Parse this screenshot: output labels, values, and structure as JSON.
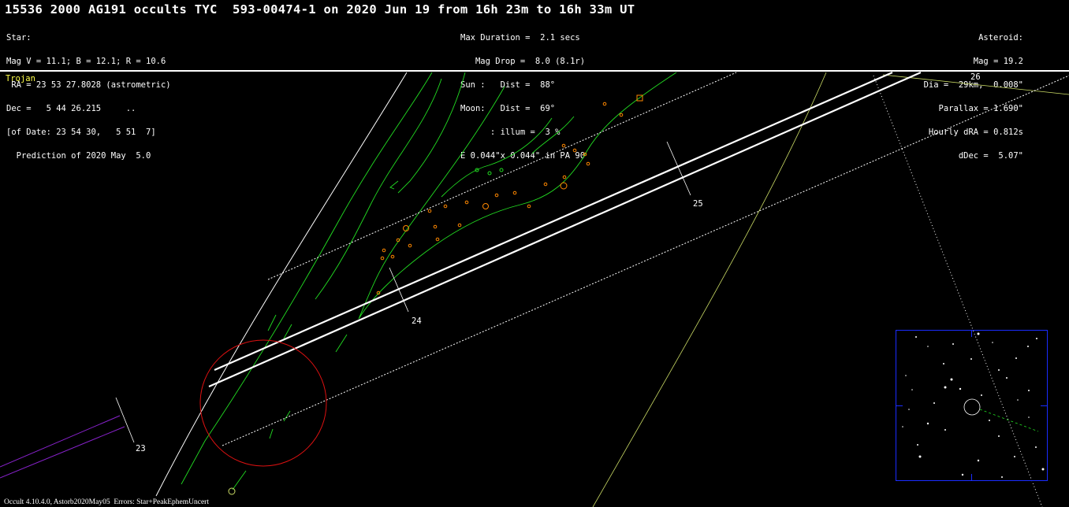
{
  "title": "15536 2000 AG191 occults TYC  593-00474-1 on 2020 Jun 19 from 16h 23m to 16h 33m UT",
  "star_block": [
    "Star:",
    "Mag V = 11.1; B = 12.1; R = 10.6",
    " RA = 23 53 27.8028 (astrometric)",
    "Dec =   5 44 26.215     ..",
    "[of Date: 23 54 30,   5 51  7]",
    "  Prediction of 2020 May  5.0"
  ],
  "event_block": [
    "Max Duration =  2.1 secs",
    "   Mag Drop =  8.0 (8.1r)",
    "Sun :   Dist =  88°",
    "Moon:   Dist =  69°",
    "      : illum =  3 %",
    "E 0.044\"x 0.044\" in PA 90"
  ],
  "asteroid_block": [
    "Asteroid:",
    "Mag = 19.2",
    "Dia =  29km,  0.008\"",
    "Parallax = 1.690\"",
    "Hourly dRA = 0.812s",
    "dDec =  5.07\""
  ],
  "class_label": "Trojan",
  "footer": "Occult 4.10.4.0, Astorb2020May05  Errors: Star+PeakEphemUncert",
  "time_labels": [
    "23",
    "24",
    "25",
    "26"
  ],
  "colors": {
    "background": "#000000",
    "path": "#ffffff",
    "coast": "#22dd22",
    "sites": "#ff8800",
    "circle": "#dd1111",
    "terminator": "#ccdd66",
    "inset_frame": "#1a2cff",
    "class_text": "#ffff4a",
    "twilight": "#8822cc"
  },
  "icons": [
    "uncertainty-circle",
    "site-marker",
    "star-chart"
  ]
}
